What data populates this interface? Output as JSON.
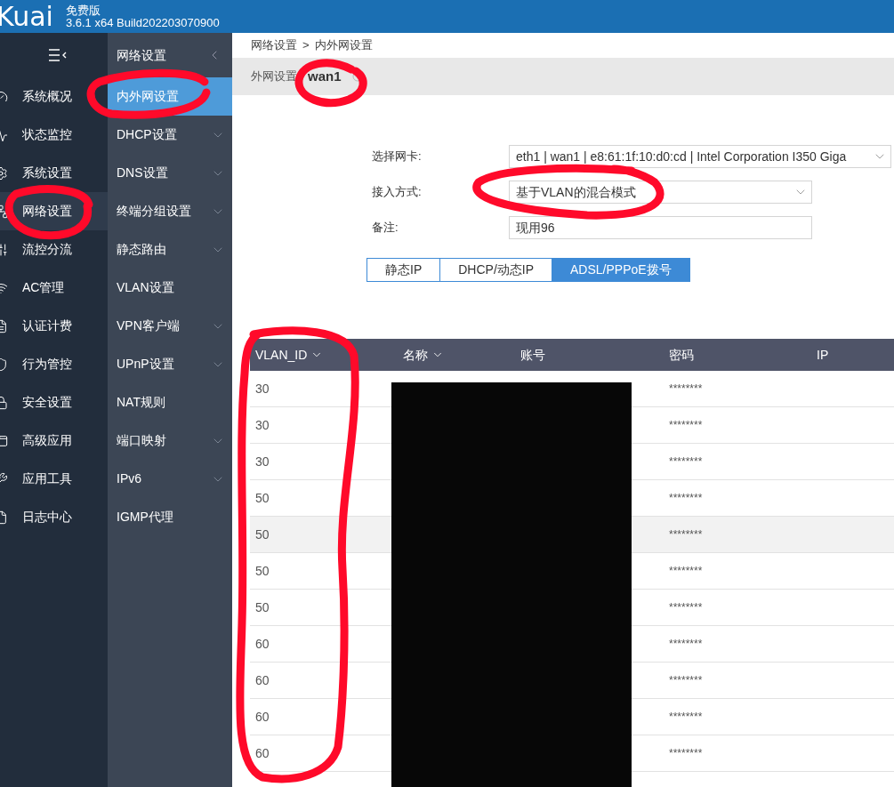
{
  "header": {
    "logo": "Kuai",
    "edition": "免费版",
    "version": "3.6.1 x64 Build202203070900"
  },
  "sidebar": {
    "items": [
      {
        "label": "系统概况",
        "selected": false
      },
      {
        "label": "状态监控",
        "selected": false
      },
      {
        "label": "系统设置",
        "selected": false
      },
      {
        "label": "网络设置",
        "selected": true
      },
      {
        "label": "流控分流",
        "selected": false
      },
      {
        "label": "AC管理",
        "selected": false
      },
      {
        "label": "认证计费",
        "selected": false
      },
      {
        "label": "行为管控",
        "selected": false
      },
      {
        "label": "安全设置",
        "selected": false
      },
      {
        "label": "高级应用",
        "selected": false
      },
      {
        "label": "应用工具",
        "selected": false
      },
      {
        "label": "日志中心",
        "selected": false
      }
    ]
  },
  "submenu": {
    "title": "网络设置",
    "items": [
      {
        "label": "内外网设置",
        "selected": true,
        "expandable": false
      },
      {
        "label": "DHCP设置",
        "selected": false,
        "expandable": true
      },
      {
        "label": "DNS设置",
        "selected": false,
        "expandable": true
      },
      {
        "label": "终端分组设置",
        "selected": false,
        "expandable": true
      },
      {
        "label": "静态路由",
        "selected": false,
        "expandable": true
      },
      {
        "label": "VLAN设置",
        "selected": false,
        "expandable": false
      },
      {
        "label": "VPN客户端",
        "selected": false,
        "expandable": true
      },
      {
        "label": "UPnP设置",
        "selected": false,
        "expandable": true
      },
      {
        "label": "NAT规则",
        "selected": false,
        "expandable": false
      },
      {
        "label": "端口映射",
        "selected": false,
        "expandable": true
      },
      {
        "label": "IPv6",
        "selected": false,
        "expandable": true
      },
      {
        "label": "IGMP代理",
        "selected": false,
        "expandable": false
      }
    ]
  },
  "breadcrumb": [
    "网络设置",
    "内外网设置"
  ],
  "breadcrumb_separator": ">",
  "section": {
    "label": "外网设置",
    "value": "wan1"
  },
  "form": [
    {
      "kind": "select",
      "label": "选择网卡:",
      "value": "eth1 | wan1 | e8:61:1f:10:d0:cd | Intel Corporation I350 Giga"
    },
    {
      "kind": "select",
      "label": "接入方式:",
      "value": "基于VLAN的混合模式"
    },
    {
      "kind": "input",
      "label": "备注:",
      "value": "现用96"
    }
  ],
  "modes": [
    {
      "label": "静态IP",
      "selected": false
    },
    {
      "label": "DHCP/动态IP",
      "selected": false
    },
    {
      "label": "ADSL/PPPoE拨号",
      "selected": true
    }
  ],
  "table": {
    "columns": [
      {
        "label": "VLAN_ID",
        "sortable": true
      },
      {
        "label": "名称",
        "sortable": true
      },
      {
        "label": "账号",
        "sortable": false
      },
      {
        "label": "密码",
        "sortable": false
      },
      {
        "label": "IP",
        "sortable": false
      }
    ],
    "rows": [
      {
        "vlan_id": "30",
        "password": "********",
        "highlighted": false
      },
      {
        "vlan_id": "30",
        "password": "********",
        "highlighted": false
      },
      {
        "vlan_id": "30",
        "password": "********",
        "highlighted": false
      },
      {
        "vlan_id": "50",
        "password": "********",
        "highlighted": false
      },
      {
        "vlan_id": "50",
        "password": "********",
        "highlighted": true
      },
      {
        "vlan_id": "50",
        "password": "********",
        "highlighted": false
      },
      {
        "vlan_id": "50",
        "password": "********",
        "highlighted": false
      },
      {
        "vlan_id": "60",
        "password": "********",
        "highlighted": false
      },
      {
        "vlan_id": "60",
        "password": "********",
        "highlighted": false
      },
      {
        "vlan_id": "60",
        "password": "********",
        "highlighted": false
      },
      {
        "vlan_id": "60",
        "password": "********",
        "highlighted": false
      }
    ]
  }
}
